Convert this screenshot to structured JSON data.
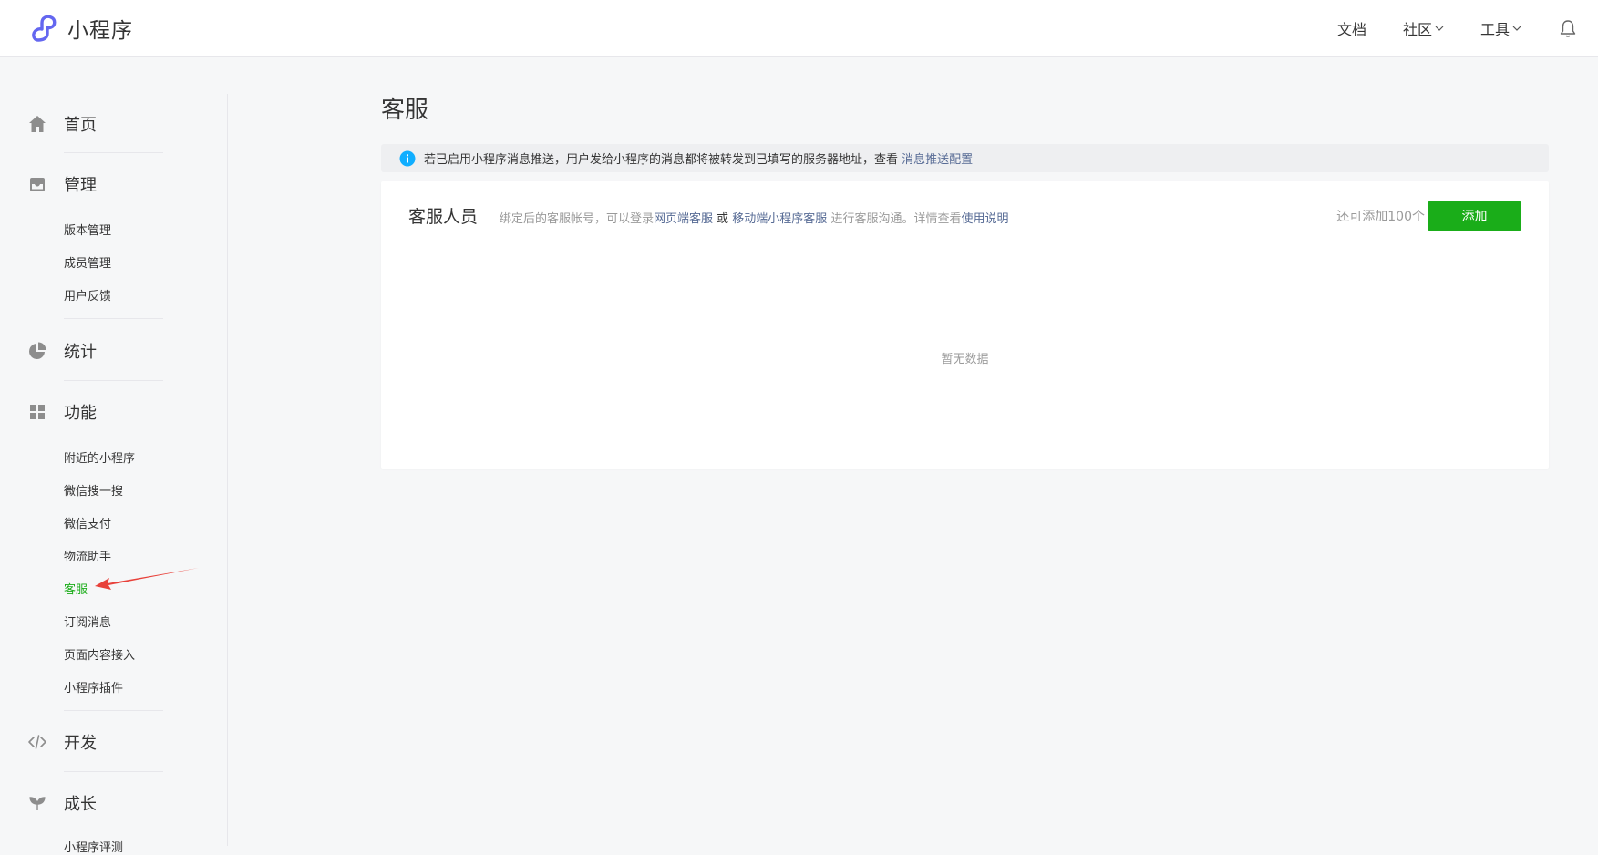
{
  "header": {
    "brand": "小程序",
    "nav": [
      {
        "label": "文档"
      },
      {
        "label": "社区"
      },
      {
        "label": "工具"
      }
    ]
  },
  "sidebar": {
    "groups": [
      {
        "label": "首页",
        "icon": "home-icon"
      },
      {
        "label": "管理",
        "icon": "inbox-icon",
        "items": [
          "版本管理",
          "成员管理",
          "用户反馈"
        ]
      },
      {
        "label": "统计",
        "icon": "pie-chart-icon"
      },
      {
        "label": "功能",
        "icon": "grid-icon",
        "items": [
          "附近的小程序",
          "微信搜一搜",
          "微信支付",
          "物流助手",
          "客服",
          "订阅消息",
          "页面内容接入",
          "小程序插件"
        ]
      },
      {
        "label": "开发",
        "icon": "code-icon"
      },
      {
        "label": "成长",
        "icon": "leaf-icon",
        "items": [
          "小程序评测"
        ]
      }
    ],
    "active_item": "客服"
  },
  "main": {
    "title": "客服",
    "notice": {
      "text": "若已启用小程序消息推送，用户发给小程序的消息都将被转发到已填写的服务器地址，查看",
      "link": "消息推送配置"
    },
    "panel": {
      "title": "客服人员",
      "desc_prefix": "绑定后的客服帐号，可以登录",
      "desc_link1": "网页端客服",
      "desc_or": " 或 ",
      "desc_link2": "移动端小程序客服",
      "desc_suffix": " 进行客服沟通。详情查看",
      "desc_link3": "使用说明",
      "quota": "还可添加100个",
      "add_label": "添加",
      "empty": "暂无数据"
    }
  },
  "colors": {
    "accent_green": "#1aad19",
    "link_blue": "#576b95",
    "info_blue": "#10aeff",
    "annotation_red": "#e8413a",
    "brand_purple": "#6467f0"
  }
}
